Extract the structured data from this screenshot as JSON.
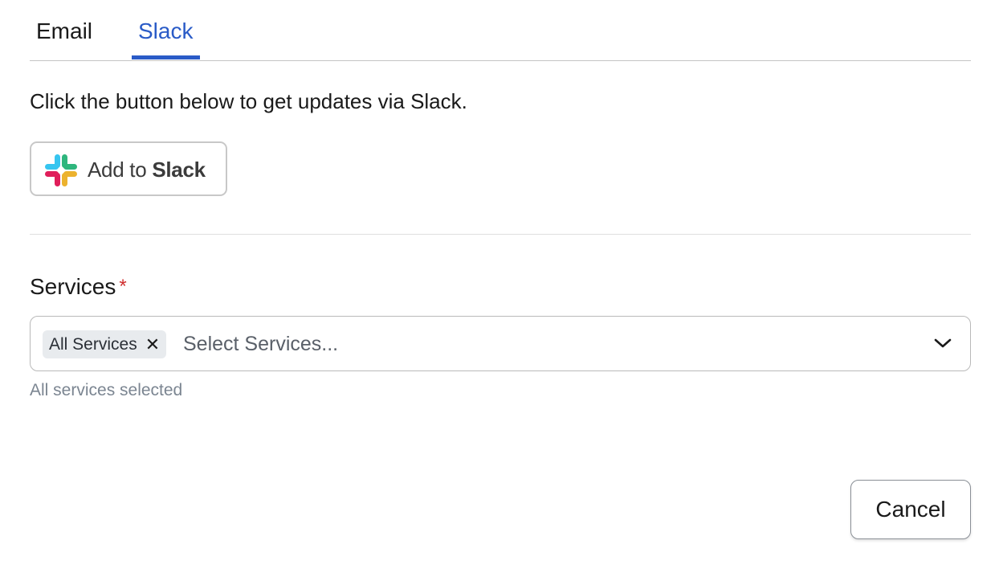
{
  "tabs": [
    {
      "label": "Email",
      "active": false
    },
    {
      "label": "Slack",
      "active": true
    }
  ],
  "colors": {
    "accent": "#2a5bc7",
    "required": "#d02f2f"
  },
  "slack": {
    "intro": "Click the button below to get updates via Slack.",
    "button_prefix": "Add to",
    "button_brand": "Slack"
  },
  "services": {
    "label": "Services",
    "required_mark": "*",
    "chips": [
      {
        "label": "All Services"
      }
    ],
    "placeholder": "Select Services...",
    "helper": "All services selected"
  },
  "footer": {
    "cancel_label": "Cancel"
  }
}
